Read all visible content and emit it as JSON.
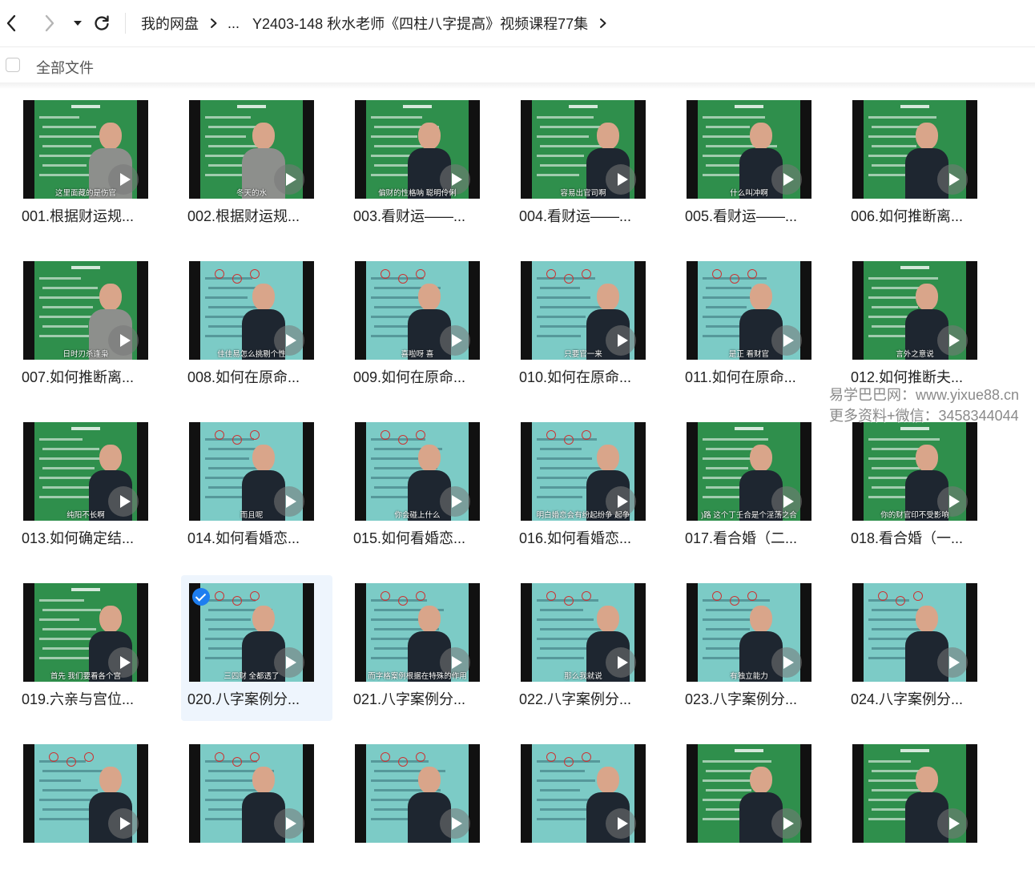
{
  "breadcrumb": {
    "root": "我的网盘",
    "ellipsis": "...",
    "current": "Y2403-148 秋水老师《四柱八字提高》视频课程77集"
  },
  "select_all": {
    "label": "全部文件",
    "checked": false
  },
  "files": [
    {
      "name": "001.根据财运规...",
      "subtitle": "这里面藏的是伤官",
      "bg": "green",
      "selected": false
    },
    {
      "name": "002.根据财运规...",
      "subtitle": "冬天的水",
      "bg": "green",
      "selected": false
    },
    {
      "name": "003.看财运——...",
      "subtitle": "偏财的性格呐  聪明伶俐",
      "bg": "green",
      "selected": false
    },
    {
      "name": "004.看财运——...",
      "subtitle": "容易出官司啊",
      "bg": "green",
      "selected": false
    },
    {
      "name": "005.看财运——...",
      "subtitle": "什么叫冲啊",
      "bg": "green",
      "selected": false
    },
    {
      "name": "006.如何推断离...",
      "subtitle": "",
      "bg": "green",
      "selected": false
    },
    {
      "name": "007.如何推断离...",
      "subtitle": "日时刃杀逢枭",
      "bg": "green",
      "selected": false
    },
    {
      "name": "008.如何在原命...",
      "subtitle": "佳佳易怎么挑剔个性",
      "bg": "cyan",
      "selected": false
    },
    {
      "name": "009.如何在原命...",
      "subtitle": "喜啦呀 喜",
      "bg": "cyan",
      "selected": false
    },
    {
      "name": "010.如何在原命...",
      "subtitle": "只要官一来",
      "bg": "cyan",
      "selected": false
    },
    {
      "name": "011.如何在原命...",
      "subtitle": "是正  看财官",
      "bg": "cyan",
      "selected": false
    },
    {
      "name": "012.如何推断夫...",
      "subtitle": "言外之意说",
      "bg": "green",
      "selected": false
    },
    {
      "name": "013.如何确定结...",
      "subtitle": "纯阳不长啊",
      "bg": "green",
      "selected": false
    },
    {
      "name": "014.如何看婚恋...",
      "subtitle": "而且呢",
      "bg": "cyan",
      "selected": false
    },
    {
      "name": "015.如何看婚恋...",
      "subtitle": "你会碰上什么",
      "bg": "cyan",
      "selected": false
    },
    {
      "name": "016.如何看婚恋...",
      "subtitle": "明白婚恋会有纷起纷争  起争",
      "bg": "cyan",
      "selected": false
    },
    {
      "name": "017.看合婚（二...",
      "subtitle": ")路  这个丁壬合是个淫荡之合",
      "bg": "green",
      "selected": false
    },
    {
      "name": "018.看合婚（一...",
      "subtitle": "你的财官印不受影响",
      "bg": "green",
      "selected": false
    },
    {
      "name": "019.六亲与宫位...",
      "subtitle": "首先  我们要看各个宫",
      "bg": "green",
      "selected": false
    },
    {
      "name": "020.八字案例分...",
      "subtitle": "三四财  全都透了",
      "bg": "cyan",
      "selected": true
    },
    {
      "name": "021.八字案例分...",
      "subtitle": "而字格案例根据在特殊的作用",
      "bg": "cyan",
      "selected": false
    },
    {
      "name": "022.八字案例分...",
      "subtitle": "那么我就说",
      "bg": "cyan",
      "selected": false
    },
    {
      "name": "023.八字案例分...",
      "subtitle": "有独立能力",
      "bg": "cyan",
      "selected": false
    },
    {
      "name": "024.八字案例分...",
      "subtitle": "",
      "bg": "cyan",
      "selected": false
    },
    {
      "name": "",
      "subtitle": "",
      "bg": "cyan",
      "selected": false
    },
    {
      "name": "",
      "subtitle": "",
      "bg": "cyan",
      "selected": false
    },
    {
      "name": "",
      "subtitle": "",
      "bg": "cyan",
      "selected": false
    },
    {
      "name": "",
      "subtitle": "",
      "bg": "cyan",
      "selected": false
    },
    {
      "name": "",
      "subtitle": "",
      "bg": "green",
      "selected": false
    },
    {
      "name": "",
      "subtitle": "",
      "bg": "green",
      "selected": false
    }
  ],
  "watermark": {
    "line1": "易学巴巴网：www.yixue88.cn",
    "line2": "更多资料+微信：3458344044"
  },
  "colors": {
    "accent": "#1e7ef0",
    "selected_bg": "#eef5fd",
    "green_board": "#2f8f4c",
    "cyan_board": "#7ccbc6"
  }
}
